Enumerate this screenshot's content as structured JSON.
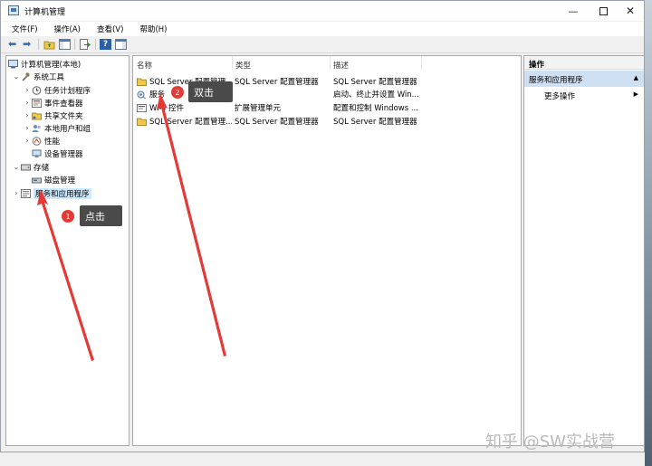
{
  "window": {
    "title": "计算机管理",
    "min_glyph": "—",
    "close_glyph": "✕"
  },
  "menu": [
    "文件(F)",
    "操作(A)",
    "查看(V)",
    "帮助(H)"
  ],
  "toolbar": {
    "back_glyph": "⬅",
    "forward_glyph": "➡",
    "help_glyph": "?"
  },
  "tree": {
    "root": "计算机管理(本地)",
    "system_tools": "系统工具",
    "system_children": [
      "任务计划程序",
      "事件查看器",
      "共享文件夹",
      "本地用户和组",
      "性能",
      "设备管理器"
    ],
    "storage": "存储",
    "storage_children": [
      "磁盘管理"
    ],
    "services_apps": "服务和应用程序",
    "expanded_glyph": "⌄",
    "collapsed_glyph": "›"
  },
  "list": {
    "columns": [
      "名称",
      "类型",
      "描述"
    ],
    "rows": [
      {
        "name": "SQL Server 配置管理...",
        "type": "SQL Server 配置管理器",
        "desc": "SQL Server 配置管理器",
        "icon": "folder-icon"
      },
      {
        "name": "服务",
        "type": "",
        "desc": "启动、终止并设置 Win...",
        "icon": "services-icon"
      },
      {
        "name": "WMI 控件",
        "type": "扩展管理单元",
        "desc": "配置和控制 Windows ...",
        "icon": "wmi-icon"
      },
      {
        "name": "SQL Server 配置管理...",
        "type": "SQL Server 配置管理器",
        "desc": "SQL Server 配置管理器",
        "icon": "folder-icon"
      }
    ]
  },
  "actions": {
    "header": "操作",
    "selected": "服务和应用程序",
    "more": "更多操作",
    "up_arrow": "▲",
    "right_arrow": "▶"
  },
  "annotations": {
    "step1_number": "1",
    "step1_label": "点击",
    "step2_number": "2",
    "step2_label": "双击",
    "arrow_color": "#e53935"
  },
  "watermark": "知乎 @SW实战营",
  "colors": {
    "selection": "#cce8ff",
    "action_selected": "#cfe0f3",
    "folder": "#f2c84b"
  }
}
